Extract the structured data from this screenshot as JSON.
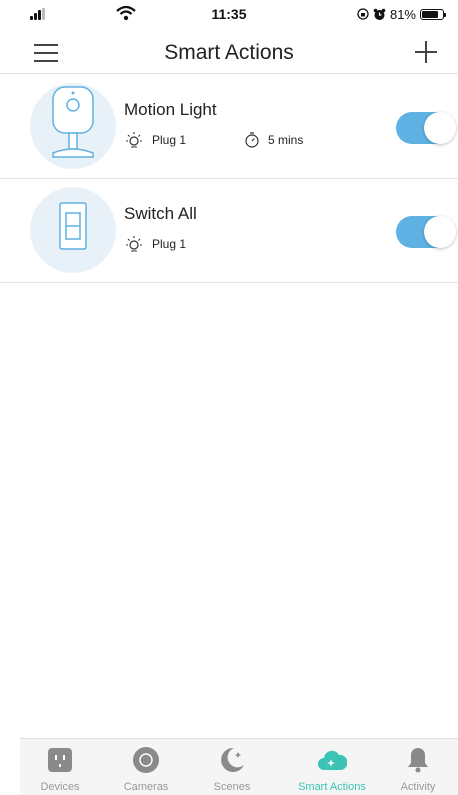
{
  "status_bar": {
    "time": "11:35",
    "battery": "81%",
    "battery_level": 0.81
  },
  "header": {
    "title": "Smart Actions"
  },
  "actions": [
    {
      "name": "Motion Light",
      "device_label": "Plug 1",
      "duration": "5 mins",
      "device_icon": "camera-icon",
      "enabled": true
    },
    {
      "name": "Switch All",
      "device_label": "Plug 1",
      "device_icon": "light-switch-icon",
      "enabled": true
    }
  ],
  "tabs": [
    {
      "label": "Devices",
      "icon": "plug-icon",
      "active": false
    },
    {
      "label": "Cameras",
      "icon": "camera-lens-icon",
      "active": false
    },
    {
      "label": "Scenes",
      "icon": "moon-icon",
      "active": false
    },
    {
      "label": "Smart Actions",
      "icon": "cloud-sparkle-icon",
      "active": true
    },
    {
      "label": "Activity",
      "icon": "bell-icon",
      "active": false
    }
  ],
  "colors": {
    "toggle_on": "#5fb1e3",
    "active_tab": "#3bc4b5",
    "inactive_tab": "#999999",
    "thumb_bg": "#e9f1f8",
    "device_line": "#5fb1e3"
  }
}
